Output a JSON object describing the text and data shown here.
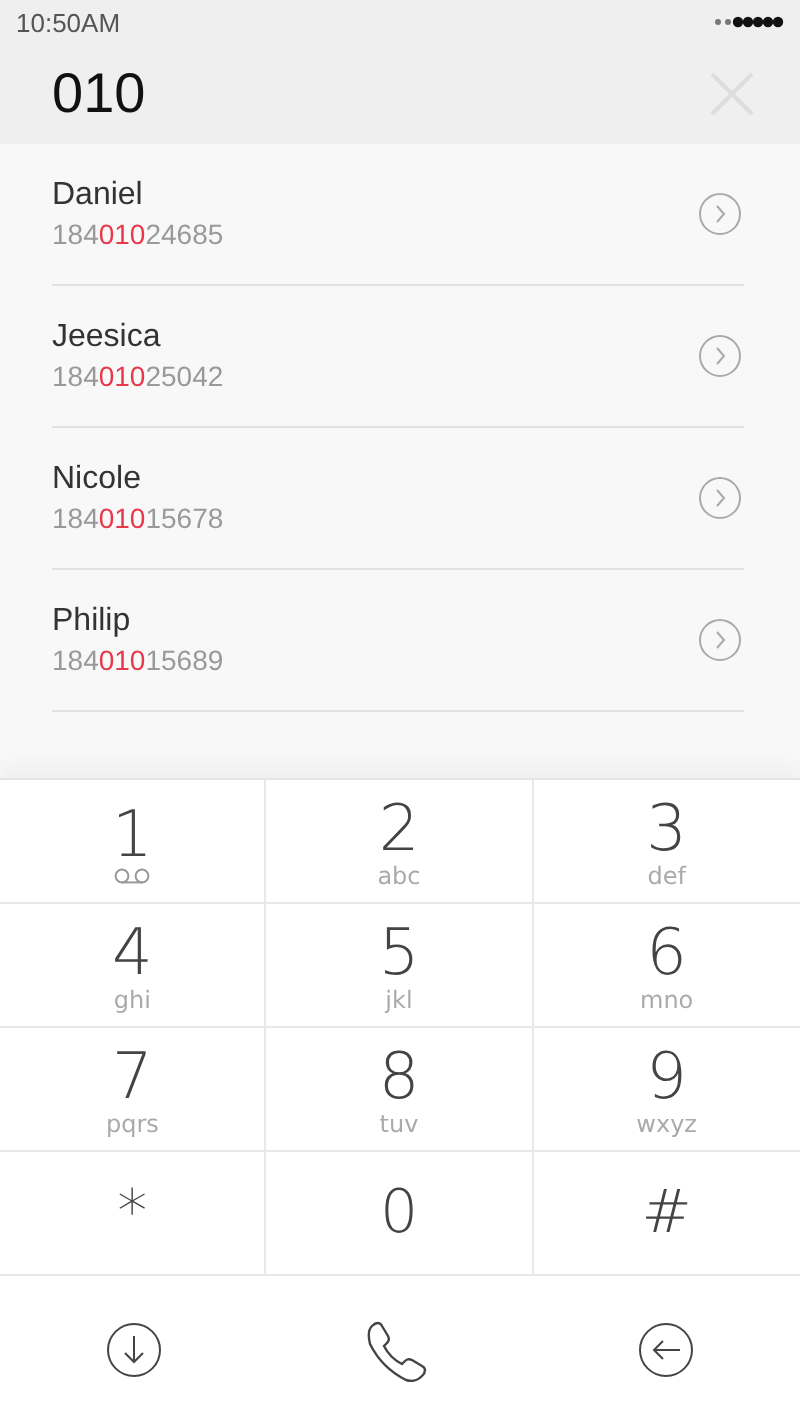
{
  "status_bar": {
    "time": "10:50AM"
  },
  "search": {
    "value": "010"
  },
  "contacts": [
    {
      "name": "Daniel",
      "number": {
        "before": "184",
        "match": "010",
        "after": "24685"
      }
    },
    {
      "name": "Jeesica",
      "number": {
        "before": "184",
        "match": "010",
        "after": "25042"
      }
    },
    {
      "name": "Nicole",
      "number": {
        "before": "184",
        "match": "010",
        "after": "15678"
      }
    },
    {
      "name": "Philip",
      "number": {
        "before": "184",
        "match": "010",
        "after": "15689"
      }
    }
  ],
  "keypad": [
    {
      "digit": "1",
      "kind": "voicemail"
    },
    {
      "digit": "2",
      "letters": "abc"
    },
    {
      "digit": "3",
      "letters": "def"
    },
    {
      "digit": "4",
      "letters": "ghi"
    },
    {
      "digit": "5",
      "letters": "jkl"
    },
    {
      "digit": "6",
      "letters": "mno"
    },
    {
      "digit": "7",
      "letters": "pqrs"
    },
    {
      "digit": "8",
      "letters": "tuv"
    },
    {
      "digit": "9",
      "letters": "wxyz"
    },
    {
      "digit": "*",
      "kind": "symbol"
    },
    {
      "digit": "0",
      "kind": "symbol"
    },
    {
      "digit": "#",
      "kind": "symbol"
    }
  ]
}
